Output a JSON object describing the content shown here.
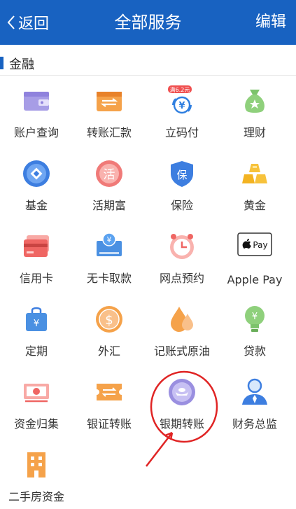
{
  "header": {
    "back_label": "返回",
    "title": "全部服务",
    "edit_label": "编辑"
  },
  "section": {
    "title": "金融"
  },
  "services": [
    {
      "label": "账户查询",
      "icon": "wallet-icon"
    },
    {
      "label": "转账汇款",
      "icon": "transfer-card-icon"
    },
    {
      "label": "立码付",
      "icon": "scan-pay-icon",
      "badge": "满6.2元"
    },
    {
      "label": "理财",
      "icon": "money-bag-icon"
    },
    {
      "label": "基金",
      "icon": "fund-coin-icon"
    },
    {
      "label": "活期富",
      "icon": "huo-badge-icon",
      "glyph": "活"
    },
    {
      "label": "保险",
      "icon": "shield-icon",
      "glyph": "保"
    },
    {
      "label": "黄金",
      "icon": "gold-bars-icon"
    },
    {
      "label": "信用卡",
      "icon": "credit-card-icon"
    },
    {
      "label": "无卡取款",
      "icon": "atm-icon",
      "glyph": "¥"
    },
    {
      "label": "网点预约",
      "icon": "clock-icon"
    },
    {
      "label": "Apple Pay",
      "icon": "apple-pay-icon",
      "glyph": "Pay"
    },
    {
      "label": "定期",
      "icon": "bag-icon",
      "glyph": "¥"
    },
    {
      "label": "外汇",
      "icon": "dollar-coin-icon",
      "glyph": "$"
    },
    {
      "label": "记账式原油",
      "icon": "oil-drop-icon"
    },
    {
      "label": "贷款",
      "icon": "bulb-icon",
      "glyph": "¥"
    },
    {
      "label": "资金归集",
      "icon": "banknote-icon"
    },
    {
      "label": "银证转账",
      "icon": "ticket-icon"
    },
    {
      "label": "银期转账",
      "icon": "ingot-icon"
    },
    {
      "label": "财务总监",
      "icon": "user-icon"
    },
    {
      "label": "二手房资金",
      "icon": "building-icon"
    }
  ],
  "colors": {
    "header": "#1862c1",
    "annotation": "#e02424"
  }
}
